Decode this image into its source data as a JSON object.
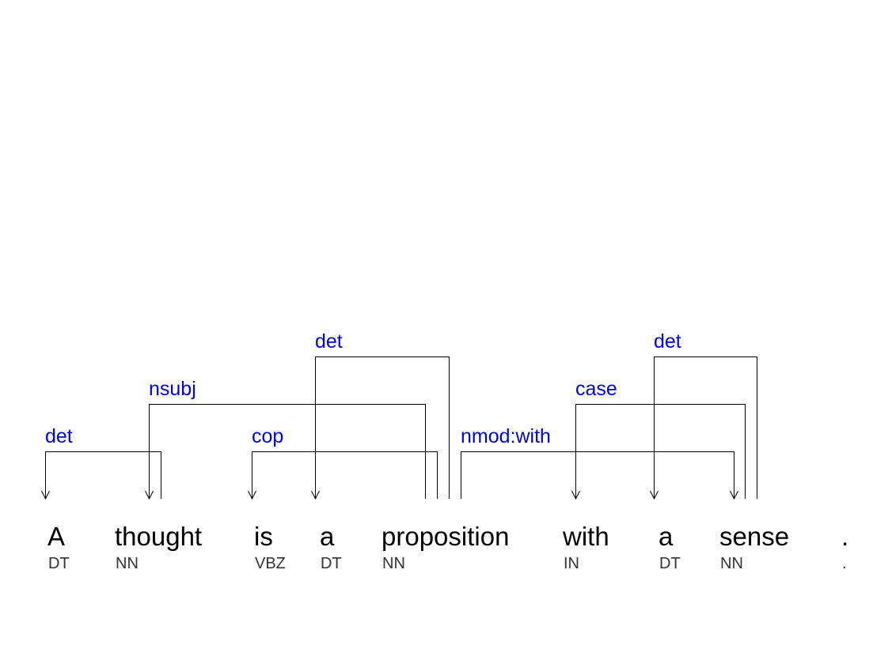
{
  "sentence": {
    "words": [
      {
        "text": "A",
        "tag": "DT"
      },
      {
        "text": "thought",
        "tag": "NN"
      },
      {
        "text": "is",
        "tag": "VBZ"
      },
      {
        "text": "a",
        "tag": "DT"
      },
      {
        "text": "proposition",
        "tag": "NN"
      },
      {
        "text": "with",
        "tag": "IN"
      },
      {
        "text": "a",
        "tag": "DT"
      },
      {
        "text": "sense",
        "tag": "NN"
      },
      {
        "text": ".",
        "tag": "."
      }
    ]
  },
  "dependencies": [
    {
      "label": "det",
      "head": 1,
      "dependent": 0
    },
    {
      "label": "nsubj",
      "head": 4,
      "dependent": 1
    },
    {
      "label": "cop",
      "head": 4,
      "dependent": 2
    },
    {
      "label": "det",
      "head": 4,
      "dependent": 3
    },
    {
      "label": "nmod:with",
      "head": 4,
      "dependent": 7
    },
    {
      "label": "case",
      "head": 7,
      "dependent": 5
    },
    {
      "label": "det",
      "head": 7,
      "dependent": 6
    }
  ],
  "colors": {
    "relation_label": "#0000ee",
    "arc": "#000000",
    "word": "#000000",
    "tag": "#333333",
    "background": "#ffffff"
  }
}
